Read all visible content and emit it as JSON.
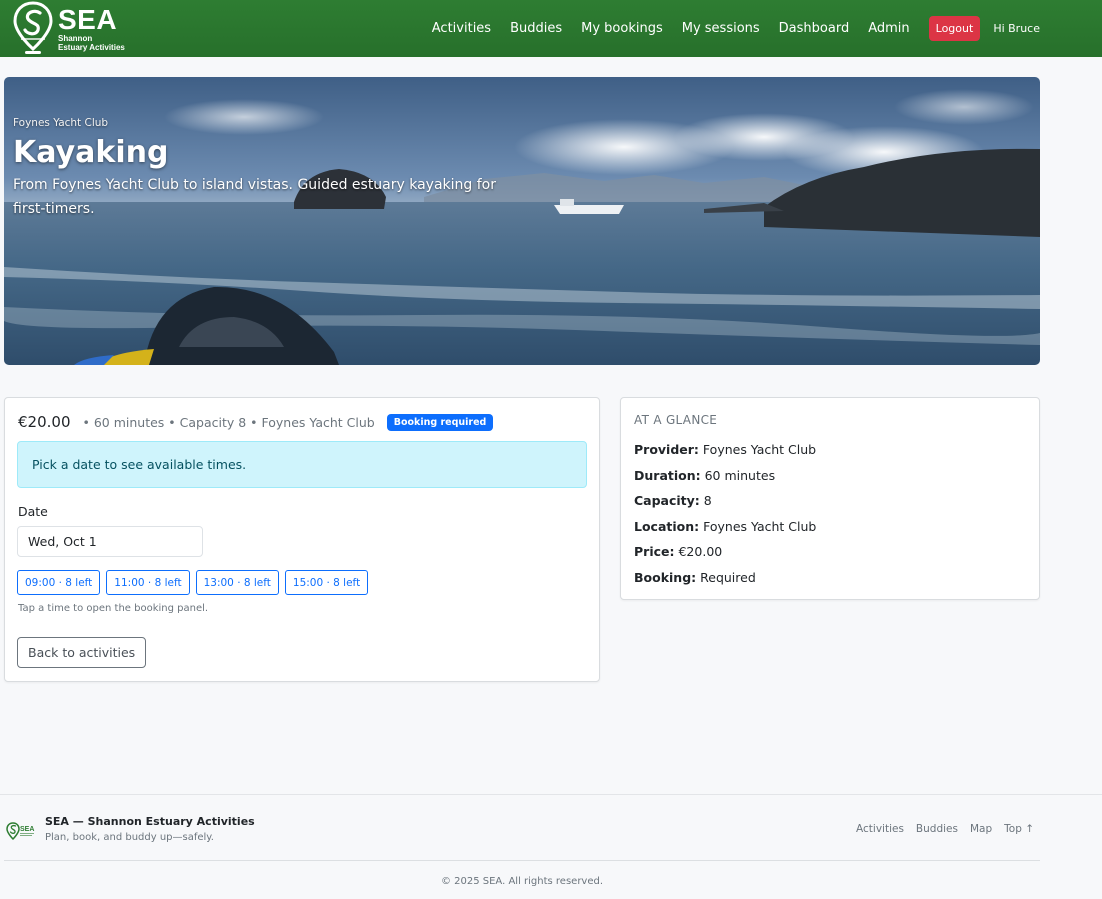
{
  "brand": {
    "name": "SEA",
    "subtitle_line1": "Shannon",
    "subtitle_line2": "Estuary Activities"
  },
  "nav": {
    "links": [
      "Activities",
      "Buddies",
      "My bookings",
      "My sessions",
      "Dashboard",
      "Admin"
    ],
    "logout_label": "Logout",
    "greeting": "Hi Bruce"
  },
  "hero": {
    "provider": "Foynes Yacht Club",
    "title": "Kayaking",
    "description": "From Foynes Yacht Club to island vistas. Guided estuary kayaking for first-timers."
  },
  "booking": {
    "price": "€20.00",
    "meta": "• 60 minutes • Capacity 8 • Foynes Yacht Club",
    "badge": "Booking required",
    "alert": "Pick a date to see available times.",
    "date_label": "Date",
    "date_value": "Wed, Oct 1",
    "slots": [
      "09:00 · 8 left",
      "11:00 · 8 left",
      "13:00 · 8 left",
      "15:00 · 8 left"
    ],
    "hint": "Tap a time to open the booking panel.",
    "back_label": "Back to activities"
  },
  "glance": {
    "title": "AT A GLANCE",
    "rows": [
      {
        "label": "Provider:",
        "value": "Foynes Yacht Club"
      },
      {
        "label": "Duration:",
        "value": "60 minutes"
      },
      {
        "label": "Capacity:",
        "value": "8"
      },
      {
        "label": "Location:",
        "value": "Foynes Yacht Club"
      },
      {
        "label": "Price:",
        "value": "€20.00"
      },
      {
        "label": "Booking:",
        "value": "Required"
      }
    ]
  },
  "footer": {
    "name": "SEA — Shannon Estuary Activities",
    "tagline": "Plan, book, and buddy up—safely.",
    "links": [
      "Activities",
      "Buddies",
      "Map",
      "Top ↑"
    ],
    "copyright": "© 2025 SEA. All rights reserved."
  },
  "colors": {
    "navbar": "#2e7d32",
    "primary": "#0d6efd",
    "danger": "#dc3545",
    "info_bg": "#cff4fc"
  }
}
